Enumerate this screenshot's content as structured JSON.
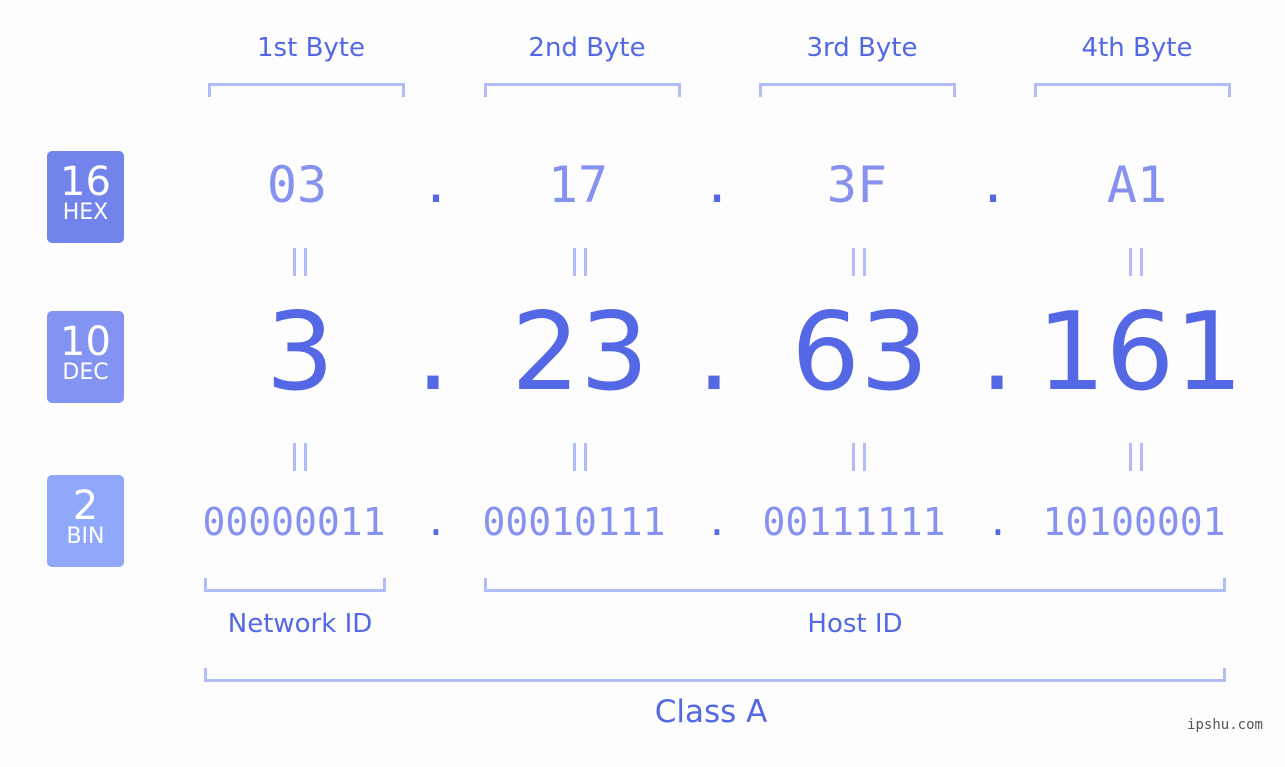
{
  "bytes": [
    {
      "label": "1st Byte",
      "hex": "03",
      "dec": "3",
      "bin": "00000011"
    },
    {
      "label": "2nd Byte",
      "hex": "17",
      "dec": "23",
      "bin": "00010111"
    },
    {
      "label": "3rd Byte",
      "hex": "3F",
      "dec": "63",
      "bin": "00111111"
    },
    {
      "label": "4th Byte",
      "hex": "A1",
      "dec": "161",
      "bin": "10100001"
    }
  ],
  "separator": ".",
  "badges": {
    "hex": {
      "base": "16",
      "label": "HEX",
      "color": "#7383ec"
    },
    "dec": {
      "base": "10",
      "label": "DEC",
      "color": "#8393f2"
    },
    "bin": {
      "base": "2",
      "label": "BIN",
      "color": "#90a8f9"
    }
  },
  "segments": {
    "network": "Network ID",
    "host": "Host ID",
    "class": "Class A"
  },
  "watermark": "ipshu.com",
  "colors": {
    "accent": "#5468e6",
    "light": "#8791ef",
    "bracket": "#b2bcf7"
  }
}
